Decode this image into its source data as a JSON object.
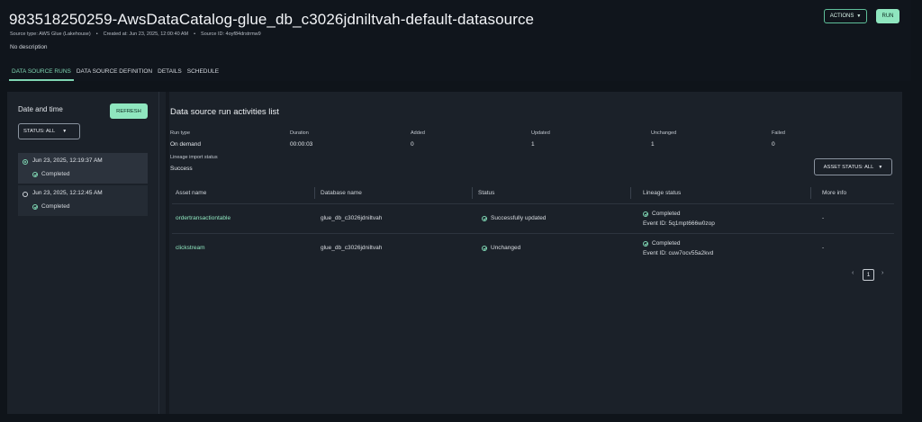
{
  "header": {
    "title": "983518250259-AwsDataCatalog-glue_db_c3026jdniltvah-default-datasource",
    "source_type": "Source type: AWS Glue (Lakehouse)",
    "created_at": "Created at: Jun 23, 2025, 12:00:40 AM",
    "source_id": "Source ID: 4oyf84drstrmw9",
    "description": "No description",
    "actions_label": "ACTIONS",
    "run_label": "RUN"
  },
  "tabs": [
    {
      "label": "DATA SOURCE RUNS",
      "active": true
    },
    {
      "label": "DATA SOURCE DEFINITION",
      "active": false
    },
    {
      "label": "DETAILS",
      "active": false
    },
    {
      "label": "SCHEDULE",
      "active": false
    }
  ],
  "left_panel": {
    "heading": "Date and time",
    "refresh_label": "REFRESH",
    "status_filter": "STATUS: ALL",
    "runs": [
      {
        "date": "Jun 23, 2025, 12:19:37 AM",
        "status": "Completed",
        "selected": true
      },
      {
        "date": "Jun 23, 2025, 12:12:45 AM",
        "status": "Completed",
        "selected": false
      }
    ]
  },
  "main": {
    "title": "Data source run activities list",
    "summary": [
      {
        "label": "Run type",
        "value": "On demand"
      },
      {
        "label": "Duration",
        "value": "00:00:03"
      },
      {
        "label": "Added",
        "value": "0"
      },
      {
        "label": "Updated",
        "value": "1"
      },
      {
        "label": "Unchanged",
        "value": "1"
      },
      {
        "label": "Failed",
        "value": "0"
      }
    ],
    "lineage_import": {
      "label": "Lineage import status",
      "value": "Success"
    },
    "asset_status_filter": "ASSET STATUS: ALL",
    "columns": [
      "Asset name",
      "Database name",
      "Status",
      "Lineage status",
      "More info"
    ],
    "rows": [
      {
        "asset": "ordertransactiontable",
        "database": "glue_db_c3026jdniltvah",
        "status": "Successfully updated",
        "lineage": "Completed",
        "event": "Event ID: 5q1mpt666w0zop",
        "more": "-"
      },
      {
        "asset": "clickstream",
        "database": "glue_db_c3026jdniltvah",
        "status": "Unchanged",
        "lineage": "Completed",
        "event": "Event ID: cuw7ocv55a2kvd",
        "more": "-"
      }
    ],
    "pagination": {
      "page": "1"
    }
  },
  "colors": {
    "accent": "#8fe6bf",
    "background": "#0f141a",
    "panel": "#1b2129"
  }
}
